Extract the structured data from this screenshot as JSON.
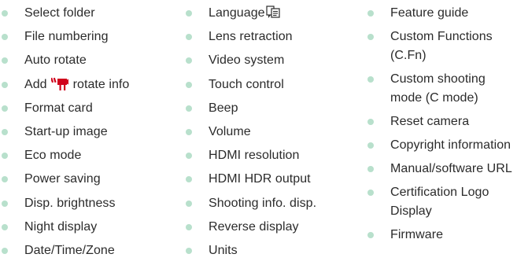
{
  "columns": [
    {
      "items": [
        {
          "label": "Select folder"
        },
        {
          "label": "File numbering"
        },
        {
          "label": "Auto rotate"
        },
        {
          "label_pre": "Add",
          "label_post": "rotate info",
          "icon": "movie-camera-icon"
        },
        {
          "label": "Format card"
        },
        {
          "label": "Start-up image"
        },
        {
          "label": "Eco mode"
        },
        {
          "label": "Power saving"
        },
        {
          "label": "Disp. brightness"
        },
        {
          "label": "Night display"
        },
        {
          "label": "Date/Time/Zone"
        }
      ]
    },
    {
      "items": [
        {
          "label": "Language",
          "icon": "language-icon"
        },
        {
          "label": "Lens retraction"
        },
        {
          "label": "Video system"
        },
        {
          "label": "Touch control"
        },
        {
          "label": "Beep"
        },
        {
          "label": "Volume"
        },
        {
          "label": "HDMI resolution"
        },
        {
          "label": "HDMI HDR output"
        },
        {
          "label": "Shooting info. disp."
        },
        {
          "label": "Reverse display"
        },
        {
          "label": "Units"
        }
      ]
    },
    {
      "items": [
        {
          "label": "Feature guide"
        },
        {
          "label": "Custom Functions (C.Fn)"
        },
        {
          "label": "Custom shooting mode (C mode)"
        },
        {
          "label": "Reset camera"
        },
        {
          "label": "Copyright information"
        },
        {
          "label": "Manual/software URL"
        },
        {
          "label": "Certification Logo Display"
        },
        {
          "label": "Firmware"
        }
      ]
    }
  ],
  "colors": {
    "bullet": "#b8e0cc",
    "text": "#2b2b2b",
    "icon": "#d0021b"
  }
}
